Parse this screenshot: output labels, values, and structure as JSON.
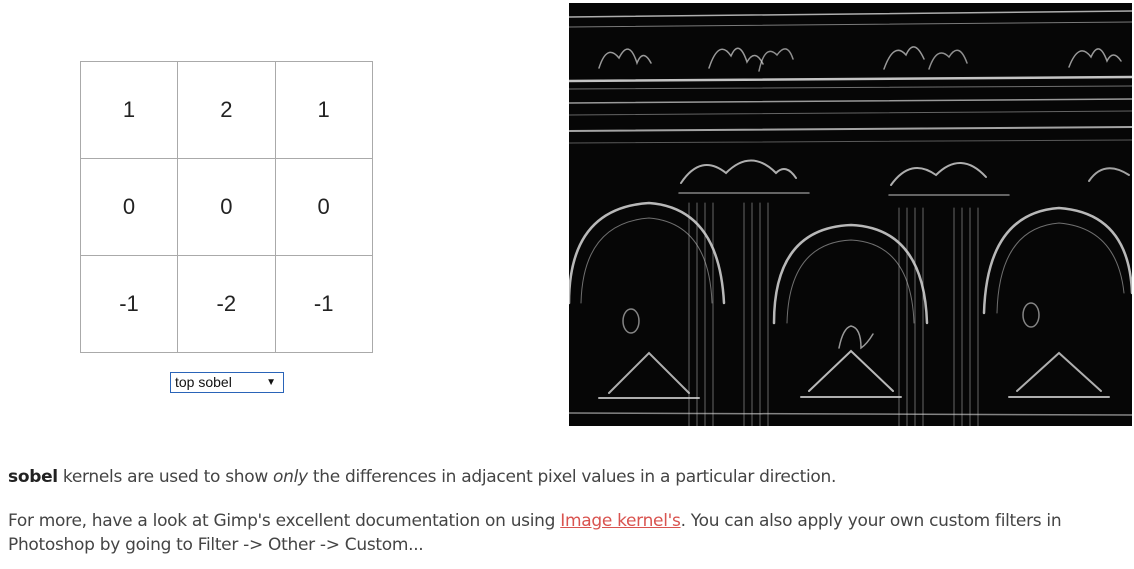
{
  "kernel": {
    "rows": [
      [
        "1",
        "2",
        "1"
      ],
      [
        "0",
        "0",
        "0"
      ],
      [
        "-1",
        "-2",
        "-1"
      ]
    ]
  },
  "preset_select": {
    "selected": "top sobel",
    "arrow_icon": "triangle-down-icon"
  },
  "output_image": {
    "description": "sobel-filtered building facade",
    "colors": {
      "background": "#060606",
      "edge": "#d8d8d8"
    }
  },
  "description": {
    "line1_bold": "sobel",
    "line1_a": " kernels are used to show ",
    "line1_em": "only",
    "line1_b": " the differences in adjacent pixel values in a particular direction.",
    "line2_a": "For more, have a look at Gimp's excellent documentation on using ",
    "line2_link": "Image kernel's",
    "line2_b": ". You can also apply your own custom filters in Photoshop by going to Filter -> Other -> Custom..."
  },
  "colors": {
    "link": "#d9534f",
    "select_border": "#2a64b8",
    "grid_border": "#aaaaaa"
  }
}
